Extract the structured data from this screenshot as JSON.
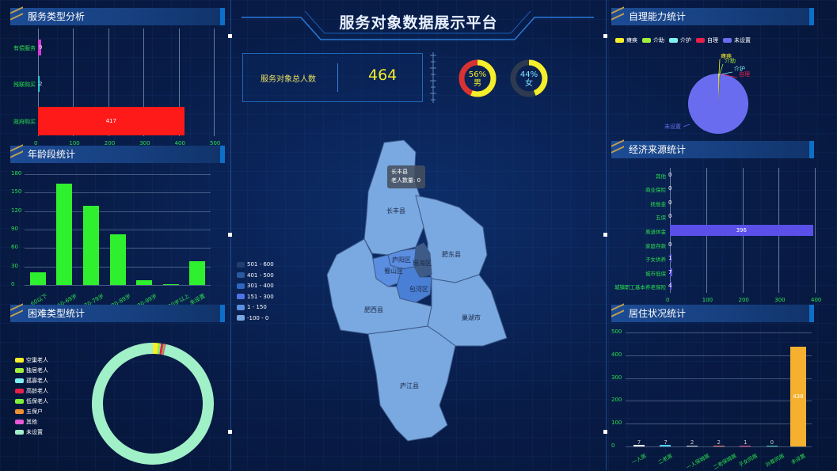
{
  "title": "服务对象数据展示平台",
  "total": {
    "label": "服务对象总人数",
    "value": "464"
  },
  "gender": [
    {
      "pct": "56%",
      "label": "男",
      "fraction": 0.56,
      "ring": "#d83232",
      "fill": "#f5ee2a",
      "text": "#f5ee2a"
    },
    {
      "pct": "44%",
      "label": "女",
      "fraction": 0.44,
      "ring": "#2e3a4f",
      "fill": "#f5ee2a",
      "text": "#7fe6ff"
    }
  ],
  "service_type": {
    "title": "服务类型分析",
    "chart_data": {
      "type": "bar",
      "orientation": "horizontal",
      "categories": [
        "有偿服务",
        "残联购买",
        "政府购买"
      ],
      "values": [
        9,
        2,
        417
      ],
      "colors": [
        "#d63bd6",
        "#2ec4d6",
        "#ff1a1a"
      ],
      "xticks": [
        "0",
        "100",
        "200",
        "300",
        "400",
        "500"
      ],
      "xlim": [
        0,
        500
      ]
    }
  },
  "age": {
    "title": "年龄段统计",
    "chart_data": {
      "type": "bar",
      "categories": [
        "60以下",
        "60-69岁",
        "70-79岁",
        "80-89岁",
        "90-99岁",
        "100岁以上",
        "未设置"
      ],
      "values": [
        21,
        165,
        128,
        82,
        8,
        1,
        39
      ],
      "yticks": [
        "0",
        "30",
        "60",
        "90",
        "120",
        "150",
        "180"
      ],
      "ylim": [
        0,
        180
      ],
      "color": "#2ef02e"
    }
  },
  "difficulty": {
    "title": "困难类型统计",
    "chart_data": {
      "type": "pie",
      "donut": true,
      "labels": [
        "空巢老人",
        "独居老人",
        "孤寡老人",
        "高龄老人",
        "低保老人",
        "五保户",
        "其他",
        "未设置"
      ],
      "values": [
        7,
        2,
        1,
        3,
        1,
        1,
        1,
        448
      ],
      "colors": [
        "#f5ee2a",
        "#9ef03a",
        "#7ff0f0",
        "#e8204a",
        "#7ef03a",
        "#f09030",
        "#e858d8",
        "#a0f0c8"
      ]
    }
  },
  "self_care": {
    "title": "自理能力统计",
    "chart_data": {
      "type": "pie",
      "labels": [
        "瘫痪",
        "介助",
        "介护",
        "自理",
        "未设置"
      ],
      "values": [
        2,
        1,
        1,
        1,
        459
      ],
      "colors": [
        "#f5ee2a",
        "#9ef03a",
        "#7ff0f0",
        "#e8204a",
        "#6a6cf0"
      ]
    }
  },
  "income": {
    "title": "经济来源统计",
    "chart_data": {
      "type": "bar",
      "orientation": "horizontal",
      "categories": [
        "其他",
        "商业保险",
        "抚恤金",
        "五保",
        "离退休金",
        "家庭存款",
        "子女供养",
        "城市低保",
        "城镇职工基本养老保险"
      ],
      "values": [
        0,
        0,
        0,
        0,
        396,
        0,
        1,
        7,
        4
      ],
      "xticks": [
        "0",
        "100",
        "200",
        "300",
        "400"
      ],
      "xlim": [
        0,
        400
      ],
      "color": "#5a4fe8"
    }
  },
  "living": {
    "title": "居住状况统计",
    "chart_data": {
      "type": "bar",
      "categories": [
        "一人居",
        "二老居",
        "一人保姆居",
        "二老保姆居",
        "子女同居",
        "孙辈同居",
        "未设置"
      ],
      "values": [
        7,
        7,
        2,
        2,
        1,
        0,
        438
      ],
      "colors": [
        "#e8e8f0",
        "#4ad0e8",
        "#d0d0d0",
        "#e87058",
        "#e04080",
        "#40c0a0",
        "#f5b030"
      ],
      "yticks": [
        "0",
        "100",
        "200",
        "300",
        "400",
        "500"
      ],
      "ylim": [
        0,
        500
      ]
    }
  },
  "map": {
    "legend": [
      "501 - 600",
      "401 - 500",
      "301 - 400",
      "151 - 300",
      "1 - 150",
      "-100 - 0"
    ],
    "legend_colors": [
      "#213e72",
      "#2a5a9c",
      "#2f66c0",
      "#4f73e6",
      "#5b8ee0",
      "#7aa8e0"
    ],
    "tooltip": {
      "name": "长丰县",
      "line": "老人数量: 0"
    },
    "districts": [
      "长丰县",
      "肥东县",
      "瑶海区",
      "庐阳区",
      "蜀山区",
      "包河区",
      "肥西县",
      "巢湖市",
      "庐江县"
    ]
  }
}
